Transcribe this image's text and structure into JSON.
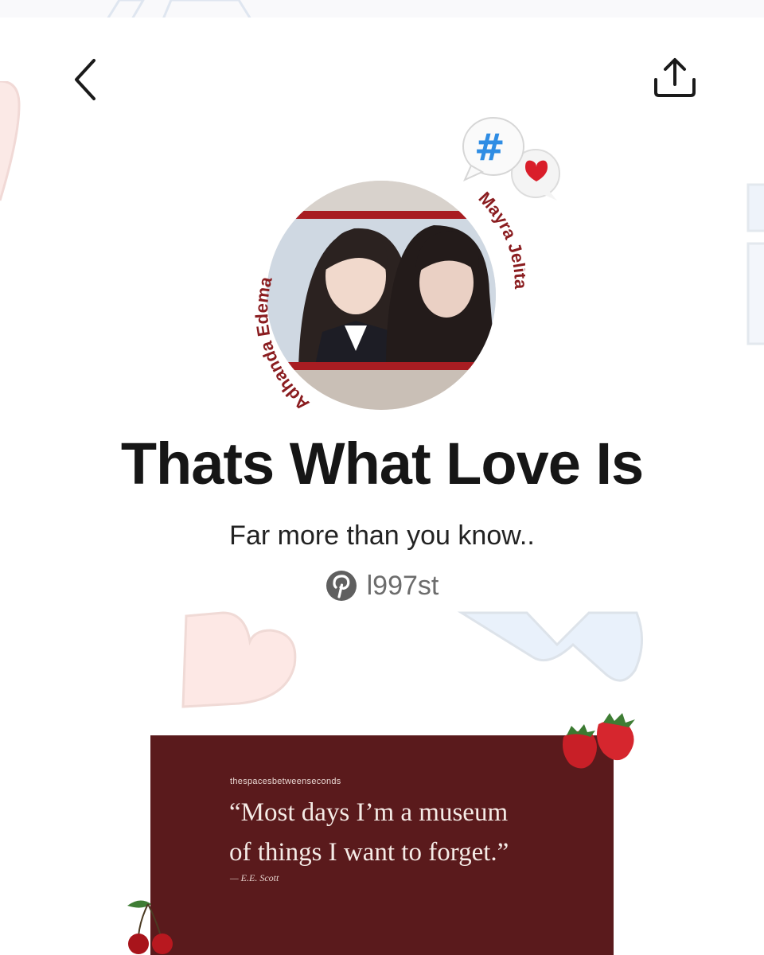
{
  "header": {
    "back_icon": "chevron-left-icon",
    "share_icon": "share-upload-icon"
  },
  "sticker": {
    "hashtag": "#",
    "icon": "chat-bubbles-heart-icon"
  },
  "avatar": {
    "left_name": "Adhanda Edema",
    "right_name": "Mayra Jelita",
    "name_color": "#8a1c1f"
  },
  "board": {
    "title": "Thats What Love Is",
    "description": "Far more than you know..",
    "owner_icon": "pinterest-icon",
    "owner": "l997st"
  },
  "quote_card": {
    "source": "thespacesbetweenseconds",
    "line1": "“Most days I’m a museum",
    "line2": "of things I want to forget.”",
    "author": "— E.E. Scott",
    "background": "#5a1a1c"
  },
  "colors": {
    "accent_red": "#8a1c1f",
    "text_dark": "#161616",
    "text_muted": "#6c6c6c"
  }
}
